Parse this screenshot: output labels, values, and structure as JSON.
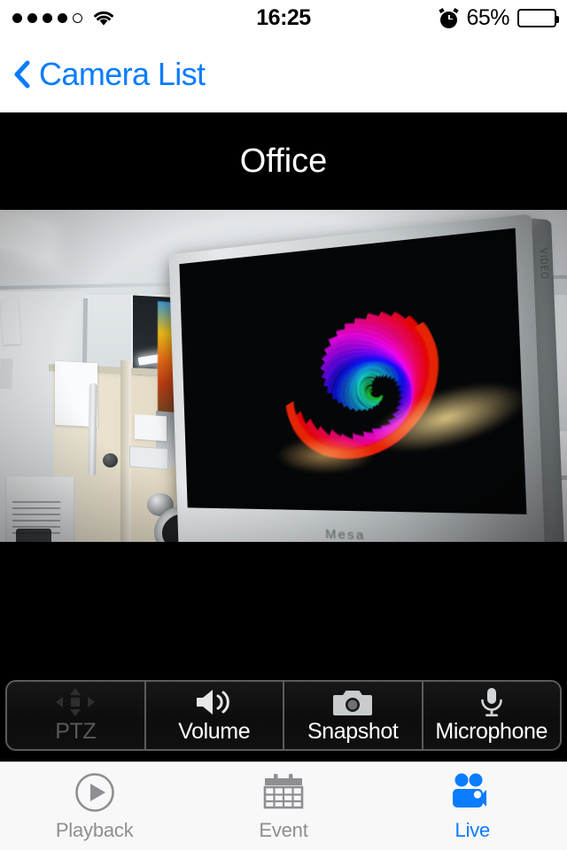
{
  "status_bar": {
    "signal_dots_filled": 4,
    "signal_dots_total": 5,
    "wifi_icon": "wifi-icon",
    "time": "16:25",
    "alarm_icon": "alarm-clock-icon",
    "battery_percent_label": "65%",
    "battery_level": 65,
    "battery_icon": "battery-icon"
  },
  "nav_bar": {
    "back_icon": "chevron-left-icon",
    "back_label": "Camera List"
  },
  "video": {
    "camera_title": "Office",
    "monitor_brand": "Mesa",
    "monitor_side_text": "VIDEO",
    "scene_description": "office-live-view"
  },
  "controls": {
    "buttons": [
      {
        "label": "PTZ",
        "icon": "ptz-dpad-icon",
        "enabled": false
      },
      {
        "label": "Volume",
        "icon": "speaker-icon",
        "enabled": true
      },
      {
        "label": "Snapshot",
        "icon": "camera-icon",
        "enabled": true
      },
      {
        "label": "Microphone",
        "icon": "microphone-icon",
        "enabled": true
      }
    ]
  },
  "tab_bar": {
    "tabs": [
      {
        "label": "Playback",
        "icon": "play-circle-icon",
        "active": false
      },
      {
        "label": "Event",
        "icon": "calendar-icon",
        "active": false
      },
      {
        "label": "Live",
        "icon": "video-camera-icon",
        "active": true
      }
    ]
  },
  "colors": {
    "accent_blue": "#0a7cff",
    "inactive_gray": "#8e8e93",
    "disabled_gray": "#59595b",
    "tab_bar_bg": "#f8f8f8",
    "toolbar_bg": "#141414",
    "video_bg": "#000000"
  }
}
